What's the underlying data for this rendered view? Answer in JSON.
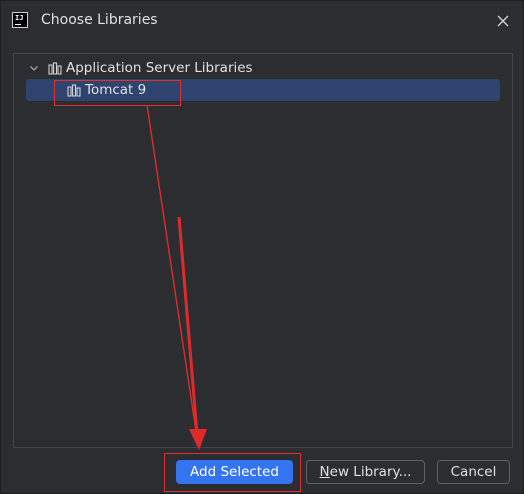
{
  "window": {
    "title": "Choose Libraries",
    "logo_text": "IJ"
  },
  "tree": {
    "root": {
      "label": "Application Server Libraries",
      "expanded": true,
      "icon": "library-icon"
    },
    "children": [
      {
        "label": "Tomcat 9",
        "selected": true,
        "icon": "library-icon"
      }
    ]
  },
  "buttons": {
    "add_selected": "Add Selected",
    "new_library_mnemonic": "N",
    "new_library_rest": "ew Library...",
    "cancel": "Cancel"
  },
  "colors": {
    "background": "#2b2d30",
    "selection": "#2e436e",
    "primary_button": "#3574f0",
    "annotation": "#e03030"
  }
}
